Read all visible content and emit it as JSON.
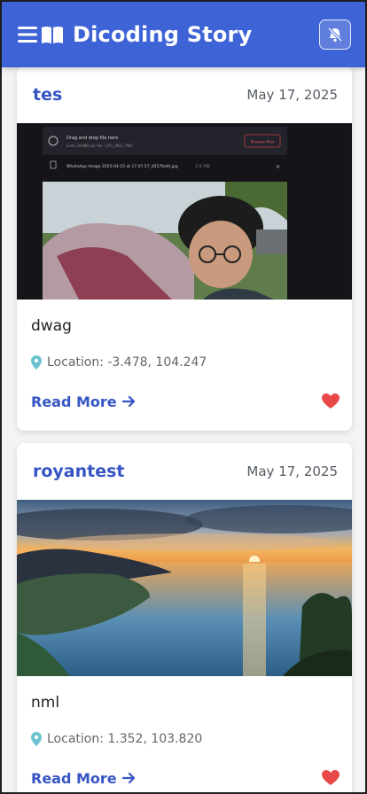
{
  "app": {
    "title": "Dicoding Story"
  },
  "stories": [
    {
      "author": "tes",
      "date": "May 17, 2025",
      "description": "dwag",
      "location": "Location: -3.478, 104.247",
      "read_more": "Read More",
      "screenshot_text": {
        "upload_prompt": "Drag and drop file here",
        "upload_limit": "Limit 200MB per file • JPG, JPEG, PNG",
        "browse": "Browse files",
        "file_name": "WhatsApp Image 2025-04-15 at 17.07.57_d5576efd.jpg",
        "file_size": "174.7KB"
      }
    },
    {
      "author": "royantest",
      "date": "May 17, 2025",
      "description": "nml",
      "location": "Location: 1.352, 103.820",
      "read_more": "Read More"
    }
  ],
  "colors": {
    "appbar": "#3e63d6",
    "accent": "#3655c4",
    "heart": "#e84a4a",
    "pin": "#6ac3cf"
  },
  "icons": {
    "menu": "hamburger-book-icon",
    "notification": "bell-off-icon",
    "location": "map-pin-icon",
    "arrow": "arrow-right-icon",
    "favorite": "heart-icon"
  }
}
